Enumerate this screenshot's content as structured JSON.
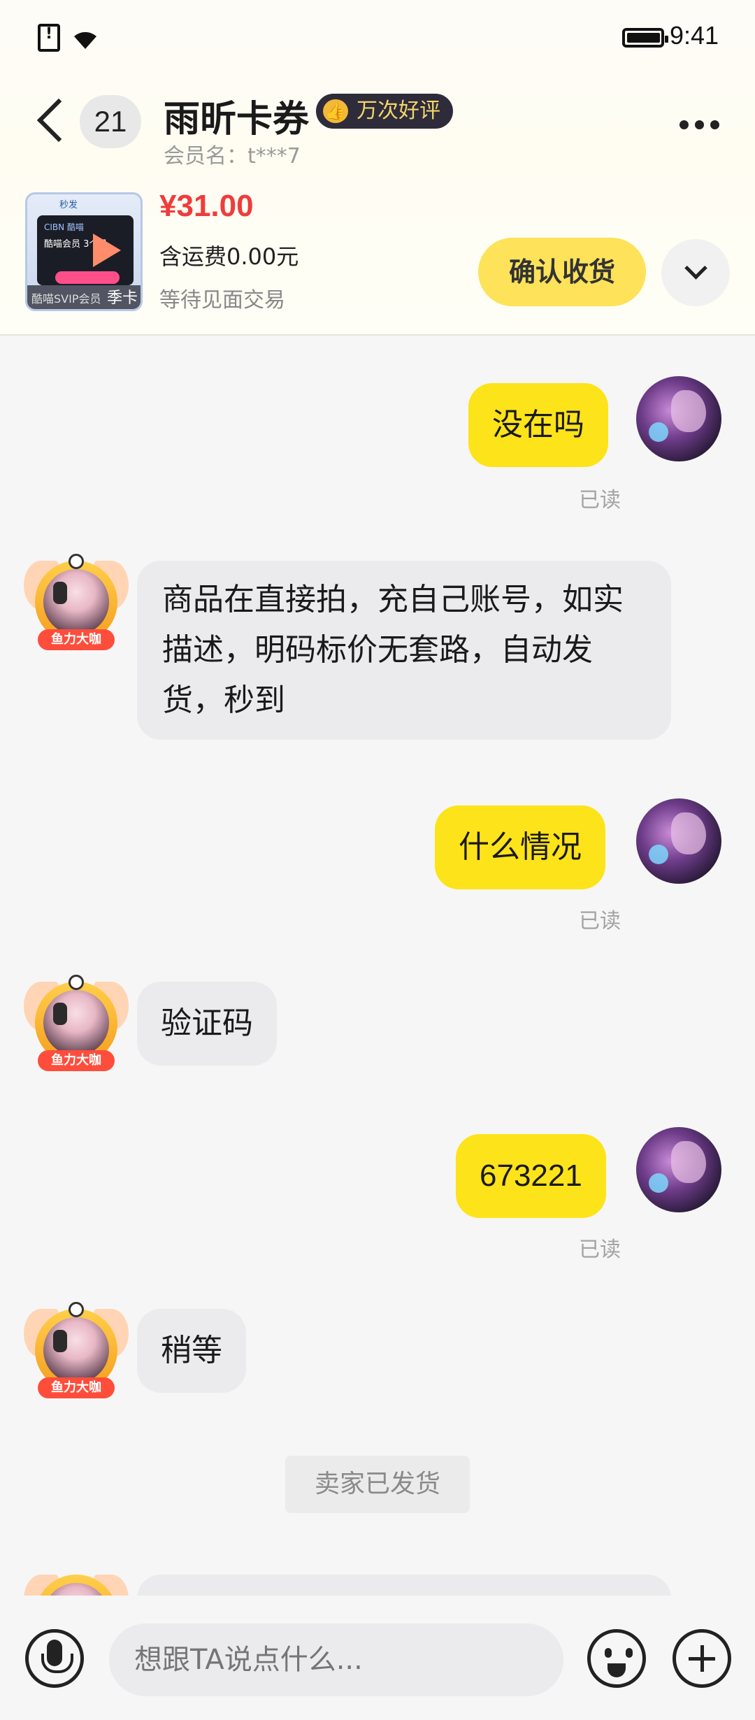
{
  "status_bar": {
    "time": "9:41"
  },
  "header": {
    "unread_count": "21",
    "seller_name": "雨昕卡券",
    "badge": "万次好评",
    "member": "会员名：t***7"
  },
  "product": {
    "thumb_label_left": "酷喵SVIP会员",
    "thumb_label_right": "季卡",
    "thumb_top": "秒发",
    "thumb_line1": "CIBN 酷喵",
    "thumb_line2": "酷喵会员 3个月",
    "price": "¥31.00",
    "shipping": "含运费0.00元",
    "status": "等待见面交易",
    "confirm_label": "确认收货"
  },
  "messages": [
    {
      "side": "mine",
      "text": "没在吗",
      "read": "已读"
    },
    {
      "side": "theirs",
      "text": "商品在直接拍，充自己账号，如实描述，明码标价无套路，自动发货，秒到"
    },
    {
      "side": "mine",
      "text": "什么情况",
      "read": "已读"
    },
    {
      "side": "theirs",
      "text": "验证码"
    },
    {
      "side": "mine",
      "text": "673221",
      "read": "已读"
    },
    {
      "side": "theirs",
      "text": "稍等"
    }
  ],
  "system_notice": "卖家已发货",
  "avatar_tag": "鱼力大咖",
  "input": {
    "placeholder": "想跟TA说点什么..."
  }
}
